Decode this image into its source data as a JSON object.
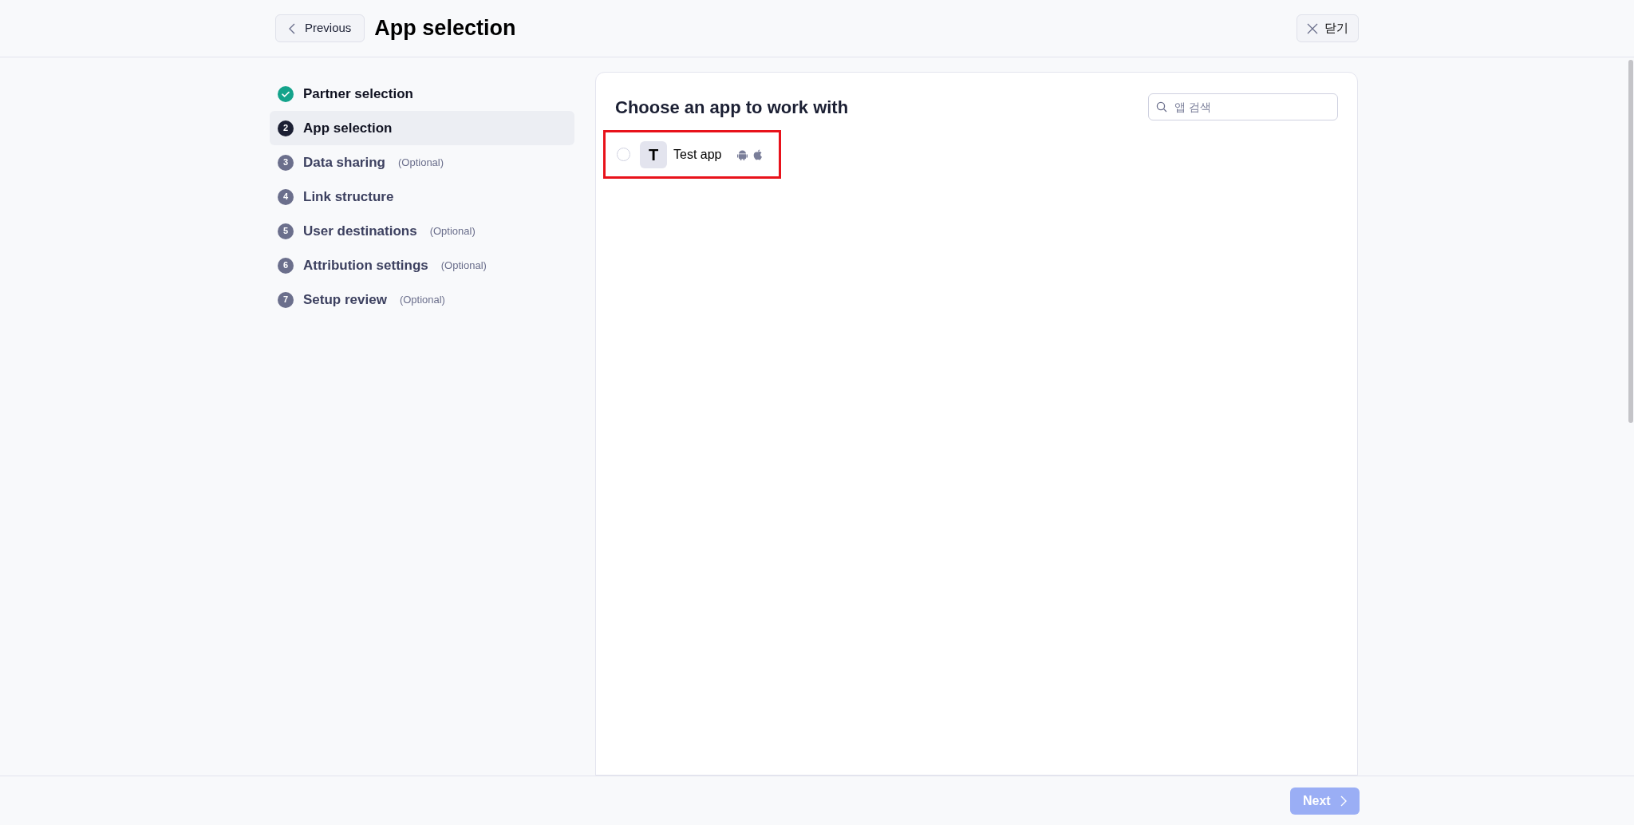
{
  "header": {
    "back_button": "Previous",
    "title": "App selection",
    "close_button": "닫기"
  },
  "steps": [
    {
      "label": "Partner selection",
      "kind": "done",
      "selected": false
    },
    {
      "number": "2",
      "label": "App selection",
      "kind": "current",
      "selected": true
    },
    {
      "number": "3",
      "label": "Data sharing",
      "optional": "(Optional)",
      "kind": "upcoming",
      "selected": false
    },
    {
      "number": "4",
      "label": "Link structure",
      "kind": "upcoming",
      "selected": false
    },
    {
      "number": "5",
      "label": "User destinations",
      "optional": "(Optional)",
      "kind": "upcoming",
      "selected": false
    },
    {
      "number": "6",
      "label": "Attribution settings",
      "optional": "(Optional)",
      "kind": "upcoming",
      "selected": false
    },
    {
      "number": "7",
      "label": "Setup review",
      "optional": "(Optional)",
      "kind": "upcoming",
      "selected": false
    }
  ],
  "panel": {
    "title": "Choose an app to work with",
    "search": {
      "placeholder": "앱 검색"
    },
    "apps": [
      {
        "initial": "T",
        "name": "Test app",
        "selected": false,
        "highlighted": true,
        "platforms": [
          {
            "kind": "android"
          },
          {
            "kind": "apple"
          }
        ]
      }
    ]
  },
  "footer": {
    "next_button": {
      "label": "Next",
      "disabled": true
    }
  }
}
